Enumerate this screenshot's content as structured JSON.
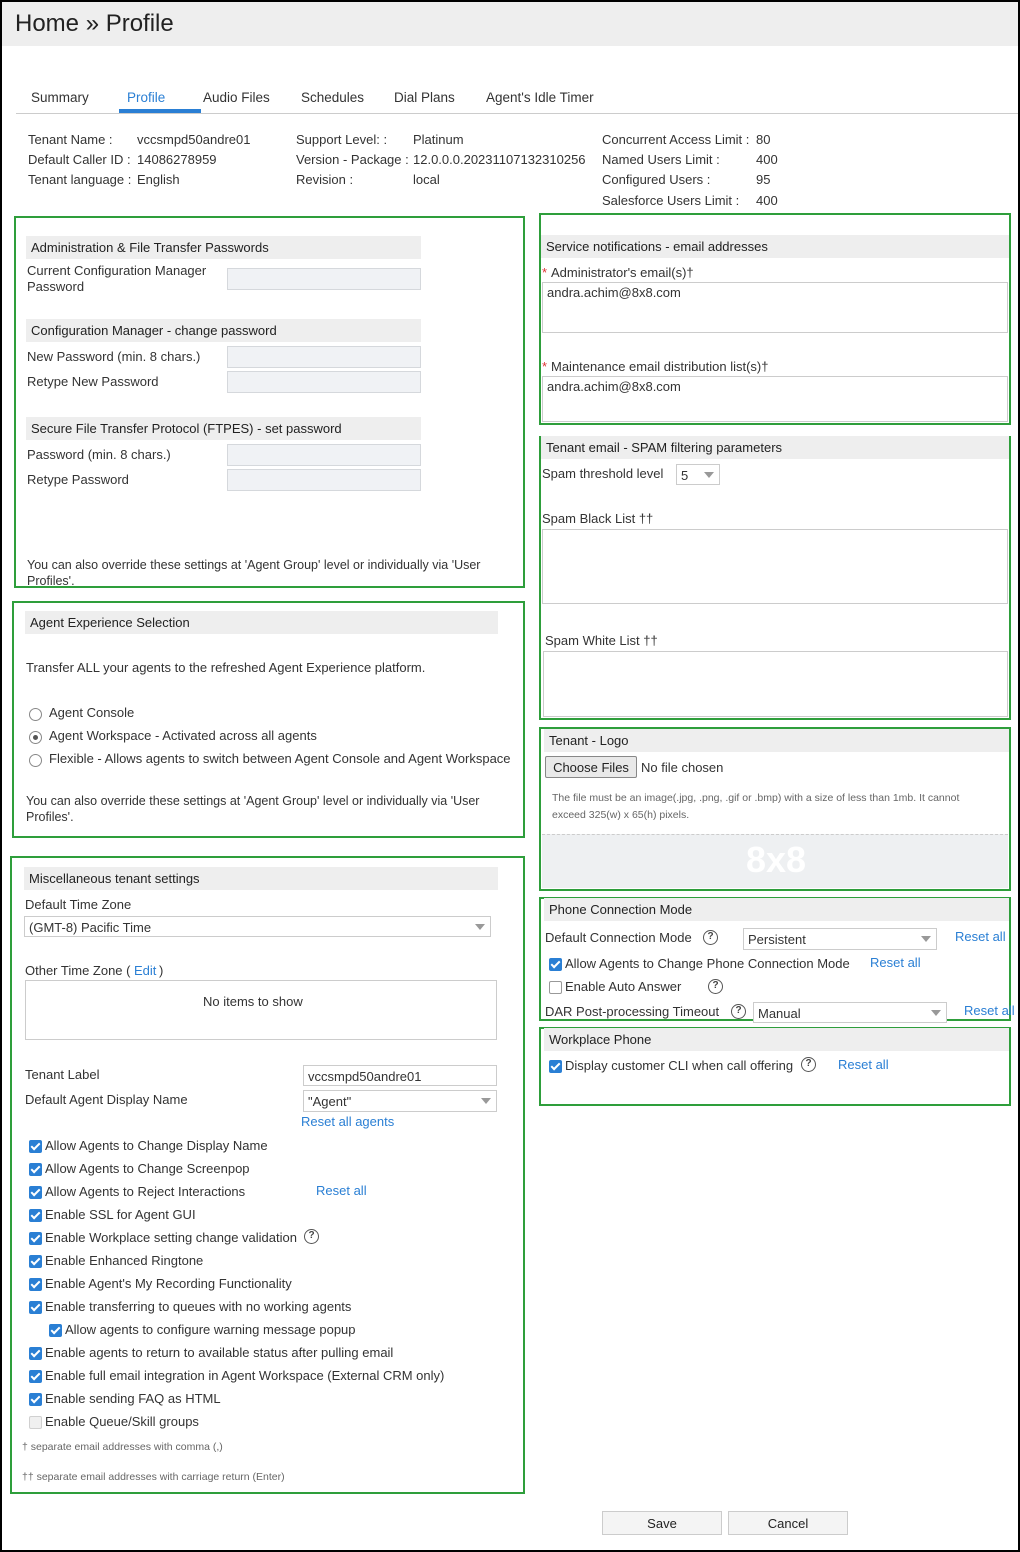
{
  "header": {
    "title": "Home » Profile"
  },
  "tabs": [
    "Summary",
    "Profile",
    "Audio Files",
    "Schedules",
    "Dial Plans",
    "Agent's Idle Timer"
  ],
  "tenant_info": {
    "tenant_name_label": "Tenant Name :",
    "tenant_name": "vccsmpd50andre01",
    "default_caller_id_label": "Default Caller ID :",
    "default_caller_id": "14086278959",
    "tenant_language_label": "Tenant language :",
    "tenant_language": "English",
    "support_level_label": "Support Level: :",
    "support_level": "Platinum",
    "version_label": "Version - Package :",
    "version": "12.0.0.0.20231107132310256",
    "revision_label": "Revision :",
    "revision": "local",
    "concurrent_label": "Concurrent Access Limit :",
    "concurrent": "80",
    "named_users_label": "Named Users Limit :",
    "named_users": "400",
    "configured_users_label": "Configured Users :",
    "configured_users": "95",
    "salesforce_label": "Salesforce Users Limit :",
    "salesforce": "400"
  },
  "passwords": {
    "heading": "Administration & File Transfer Passwords",
    "current_config_label_1": "Current Configuration Manager",
    "current_config_label_2": "Password",
    "config_change_heading": "Configuration Manager - change password",
    "new_password_label": "New Password (min. 8 chars.)",
    "retype_new_label": "Retype New Password",
    "ftpes_heading": "Secure File Transfer Protocol (FTPES) - set password",
    "password_label": "Password (min. 8 chars.)",
    "retype_label": "Retype Password",
    "override_1": "You can also override these settings at 'Agent Group' level or individually via 'User",
    "override_2": "Profiles'."
  },
  "agent_experience": {
    "heading": "Agent Experience Selection",
    "description": "Transfer ALL your agents to the refreshed Agent Experience platform.",
    "options": [
      "Agent Console",
      "Agent Workspace - Activated across all agents",
      "Flexible - Allows agents to switch between Agent Console and Agent Workspace"
    ],
    "selected_index": 1,
    "override_1": "You can also override these settings at 'Agent Group' level or individually via 'User",
    "override_2": "Profiles'."
  },
  "misc": {
    "heading": "Miscellaneous tenant settings",
    "default_tz_label": "Default Time Zone",
    "default_tz_value": "(GMT-8) Pacific Time",
    "other_tz_label": "Other Time Zone (",
    "other_tz_edit": "Edit",
    "other_tz_close": ")",
    "no_items": "No items to show",
    "tenant_label_label": "Tenant Label",
    "tenant_label_value": "vccsmpd50andre01",
    "display_name_label": "Default Agent Display Name",
    "display_name_value": "\"Agent\"",
    "reset_all_agents": "Reset all agents",
    "reset_all": "Reset all",
    "checkboxes": [
      "Allow Agents to Change Display Name",
      "Allow Agents to Change Screenpop",
      "Allow Agents to Reject Interactions",
      "Enable SSL for Agent GUI",
      "Enable Workplace setting change validation",
      "Enable Enhanced Ringtone",
      "Enable Agent's My Recording Functionality",
      "Enable transferring to queues with no working agents",
      "Allow agents to configure warning message popup",
      "Enable agents to return to available status after pulling email",
      "Enable full email integration in Agent Workspace (External CRM only)",
      "Enable sending FAQ as HTML",
      "Enable Queue/Skill groups"
    ],
    "footnote_1": "† separate email addresses with comma (,)",
    "footnote_2": "†† separate email addresses with carriage return (Enter)"
  },
  "service_notifications": {
    "heading": "Service notifications - email addresses",
    "admin_label": "Administrator's email(s)†",
    "admin_value": "andra.achim@8x8.com",
    "maint_label": "Maintenance email distribution list(s)†",
    "maint_value": "andra.achim@8x8.com",
    "required_mark": "*"
  },
  "spam": {
    "heading": "Tenant email - SPAM filtering parameters",
    "threshold_label": "Spam threshold level",
    "threshold_value": "5",
    "black_list_label": "Spam Black List ††",
    "white_list_label": "Spam White List ††"
  },
  "logo": {
    "heading": "Tenant - Logo",
    "choose_files": "Choose Files",
    "no_file": "No file chosen",
    "hint_1": "The file must be an image(.jpg, .png, .gif or .bmp) with a size of less than 1mb. It cannot",
    "hint_2": "exceed 325(w) x 65(h) pixels.",
    "logo_text": "8x8"
  },
  "phone_connection": {
    "heading": "Phone Connection Mode",
    "default_mode_label": "Default Connection Mode",
    "default_mode_value": "Persistent",
    "allow_change_label": "Allow Agents to Change Phone Connection Mode",
    "auto_answer_label": "Enable Auto Answer",
    "dar_label": "DAR Post-processing Timeout",
    "dar_value": "Manual",
    "reset_all": "Reset all"
  },
  "workplace_phone": {
    "heading": "Workplace Phone",
    "display_cli_label": "Display customer CLI when call offering",
    "reset_all": "Reset all"
  },
  "footer": {
    "save": "Save",
    "cancel": "Cancel"
  }
}
